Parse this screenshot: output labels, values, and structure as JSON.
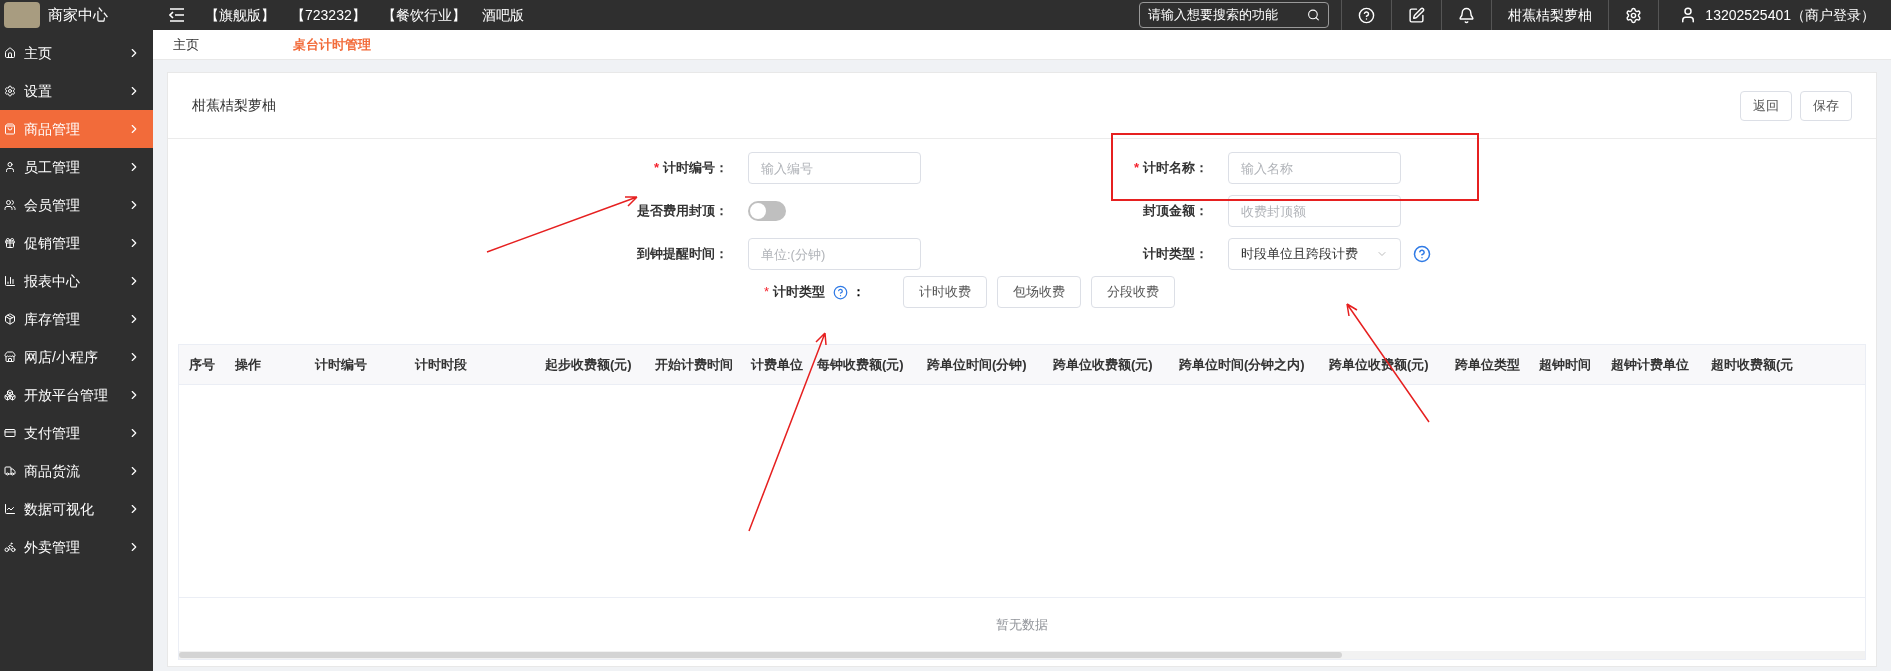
{
  "header": {
    "brand": "商家中心",
    "tags": [
      "【旗舰版】",
      "【723232】",
      "【餐饮行业】",
      "酒吧版"
    ],
    "search": {
      "placeholder": "请输入想要搜索的功能"
    },
    "shop": "柑蕉桔梨萝柚",
    "user": "13202525401（商户登录）"
  },
  "sidebar": {
    "items": [
      {
        "label": "主页",
        "selected": false
      },
      {
        "label": "设置",
        "selected": false
      },
      {
        "label": "商品管理",
        "selected": true
      },
      {
        "label": "员工管理",
        "selected": false
      },
      {
        "label": "会员管理",
        "selected": false
      },
      {
        "label": "促销管理",
        "selected": false
      },
      {
        "label": "报表中心",
        "selected": false
      },
      {
        "label": "库存管理",
        "selected": false
      },
      {
        "label": "网店/小程序",
        "selected": false
      },
      {
        "label": "开放平台管理",
        "selected": false
      },
      {
        "label": "支付管理",
        "selected": false
      },
      {
        "label": "商品货流",
        "selected": false
      },
      {
        "label": "数据可视化",
        "selected": false
      },
      {
        "label": "外卖管理",
        "selected": false
      }
    ]
  },
  "breadcrumb": [
    {
      "label": "主页",
      "selected": false
    },
    {
      "label": "桌台计时管理",
      "selected": true
    }
  ],
  "card": {
    "title": "柑蕉桔梨萝柚",
    "buttons": [
      "返回",
      "保存"
    ]
  },
  "form": {
    "asterisk": "*",
    "left": [
      {
        "kind": "input",
        "label": "计时编号：",
        "required": true,
        "placeholder": "输入编号"
      },
      {
        "kind": "switch",
        "label": "是否费用封顶：",
        "required": false,
        "on": false
      },
      {
        "kind": "input",
        "label": "到钟提醒时间：",
        "required": false,
        "placeholder": "单位:(分钟)"
      }
    ],
    "right": [
      {
        "kind": "input",
        "label": "计时名称：",
        "required": true,
        "placeholder": "输入名称"
      },
      {
        "kind": "input",
        "label": "封顶金额：",
        "required": false,
        "placeholder": "收费封顶额"
      },
      {
        "kind": "select",
        "label": "计时类型：",
        "required": false,
        "value": "时段单位且跨段计费"
      }
    ],
    "type_row": {
      "label": "计时类型",
      "colon": "：",
      "required": true,
      "buttons": [
        "计时收费",
        "包场收费",
        "分段收费"
      ]
    }
  },
  "table": {
    "columns": [
      "序号",
      "操作",
      "计时编号",
      "计时时段",
      "起步收费额(元)",
      "开始计费时间",
      "计费单位",
      "每钟收费额(元)",
      "跨单位时间(分钟)",
      "跨单位收费额(元)",
      "跨单位时间(分钟之内)",
      "跨单位收费额(元)",
      "跨单位类型",
      "超钟时间",
      "超钟计费单位",
      "超时收费额(元"
    ],
    "empty_text": "暂无数据"
  }
}
